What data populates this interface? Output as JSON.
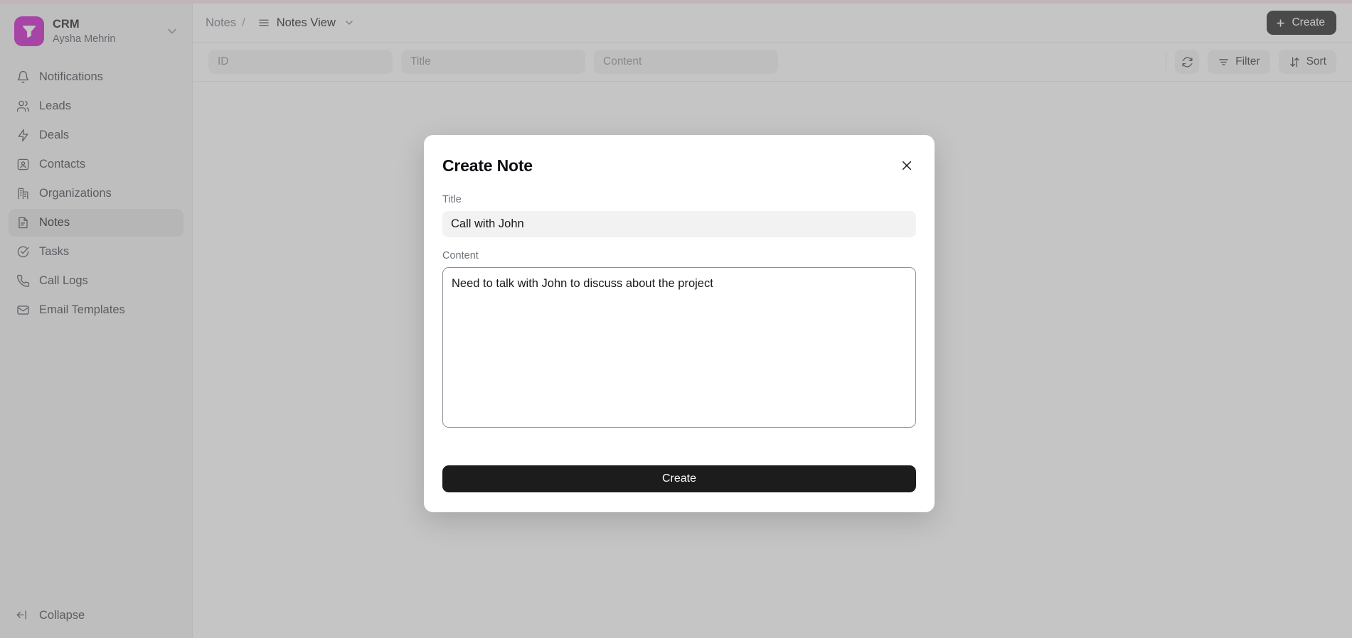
{
  "brand": {
    "logo_icon": "funnel-icon",
    "title": "CRM",
    "user": "Aysha Mehrin",
    "caret_icon": "chevron-down-icon",
    "accent_color": "#c814c8"
  },
  "sidebar": {
    "items": [
      {
        "icon": "bell-icon",
        "label": "Notifications",
        "active": false
      },
      {
        "icon": "users-icon",
        "label": "Leads",
        "active": false
      },
      {
        "icon": "bolt-icon",
        "label": "Deals",
        "active": false
      },
      {
        "icon": "contact-icon",
        "label": "Contacts",
        "active": false
      },
      {
        "icon": "building-icon",
        "label": "Organizations",
        "active": false
      },
      {
        "icon": "note-icon",
        "label": "Notes",
        "active": true
      },
      {
        "icon": "check-circle-icon",
        "label": "Tasks",
        "active": false
      },
      {
        "icon": "phone-icon",
        "label": "Call Logs",
        "active": false
      },
      {
        "icon": "envelope-icon",
        "label": "Email Templates",
        "active": false
      }
    ],
    "collapse": {
      "icon": "collapse-left-icon",
      "label": "Collapse"
    }
  },
  "topbar": {
    "breadcrumb_root": "Notes",
    "breadcrumb_separator": "/",
    "view_icon": "list-icon",
    "view_name": "Notes View",
    "view_caret_icon": "chevron-down-icon",
    "create_label": "Create",
    "create_icon": "plus-icon"
  },
  "filterbar": {
    "id_placeholder": "ID",
    "id_value": "",
    "title_placeholder": "Title",
    "title_value": "",
    "content_placeholder": "Content",
    "content_value": "",
    "refresh_icon": "refresh-icon",
    "filter_label": "Filter",
    "filter_icon": "filter-icon",
    "sort_label": "Sort",
    "sort_icon": "sort-arrows-icon"
  },
  "modal": {
    "title": "Create Note",
    "close_icon": "close-icon",
    "title_field": {
      "label": "Title",
      "value": "Call with John",
      "placeholder": "Title"
    },
    "content_field": {
      "label": "Content",
      "value": "Need to talk with John to discuss about the project",
      "placeholder": "Content"
    },
    "submit_label": "Create"
  }
}
